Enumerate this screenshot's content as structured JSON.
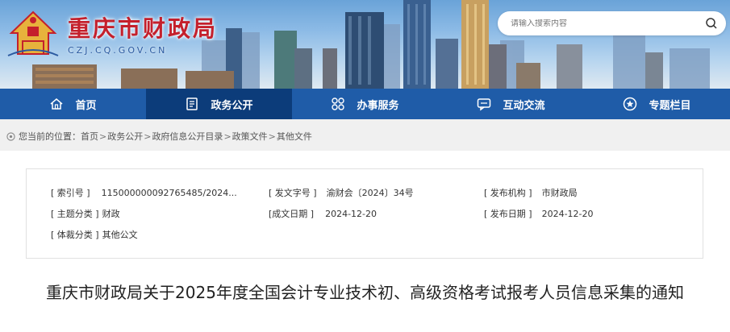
{
  "header": {
    "site_title": "重庆市财政局",
    "site_domain": "CZJ.CQ.GOV.CN"
  },
  "search": {
    "placeholder": "请输入搜索内容"
  },
  "nav": {
    "items": [
      {
        "label": "首页",
        "icon": "home-icon"
      },
      {
        "label": "政务公开",
        "icon": "document-icon"
      },
      {
        "label": "办事服务",
        "icon": "grid-icon"
      },
      {
        "label": "互动交流",
        "icon": "chat-icon"
      },
      {
        "label": "专题栏目",
        "icon": "star-icon"
      }
    ],
    "active": "政务公开"
  },
  "breadcrumb": {
    "prefix": "您当前的位置：",
    "items": [
      "首页",
      "政务公开",
      "政府信息公开目录",
      "政策文件",
      "其他文件"
    ],
    "separator": ">"
  },
  "meta": {
    "index_no_label": "[ 索引号 ]",
    "index_no_value": "11500000009276548​5/2024...",
    "doc_no_label": "[ 发文字号 ]",
    "doc_no_value": "渝财会〔2024〕34号",
    "publisher_label": "[ 发布机构 ]",
    "publisher_value": "市财政局",
    "topic_label": "[ 主题分类 ]",
    "topic_value": "财政",
    "created_label": "[成文日期 ]",
    "created_value": "2024-12-20",
    "published_label": "[ 发布日期 ]",
    "published_value": "2024-12-20",
    "genre_label": "[ 体裁分类 ]",
    "genre_value": "其他公文"
  },
  "document": {
    "title": "重庆市财政局关于2025年度全国会计专业技术初、高级资格考试报考人员信息采集的通知"
  },
  "colors": {
    "nav_bg": "#1f5ca8",
    "nav_active": "#0c3c7a",
    "title_red": "#c4202c"
  }
}
